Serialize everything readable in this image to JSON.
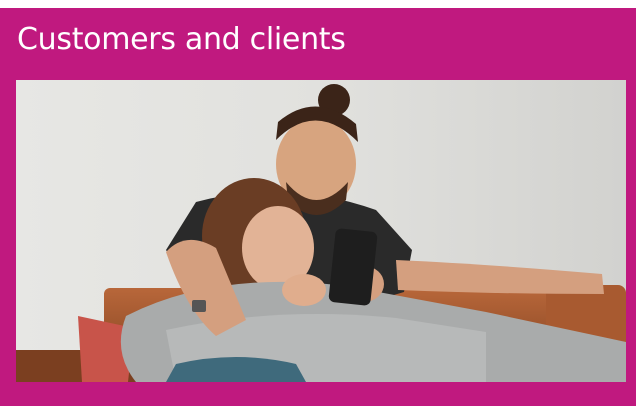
{
  "card": {
    "title": "Customers and clients",
    "background_color": "#c0197f",
    "title_color": "#ffffff"
  },
  "image": {
    "subject": "couple-on-sofa-looking-at-phone-photo"
  }
}
